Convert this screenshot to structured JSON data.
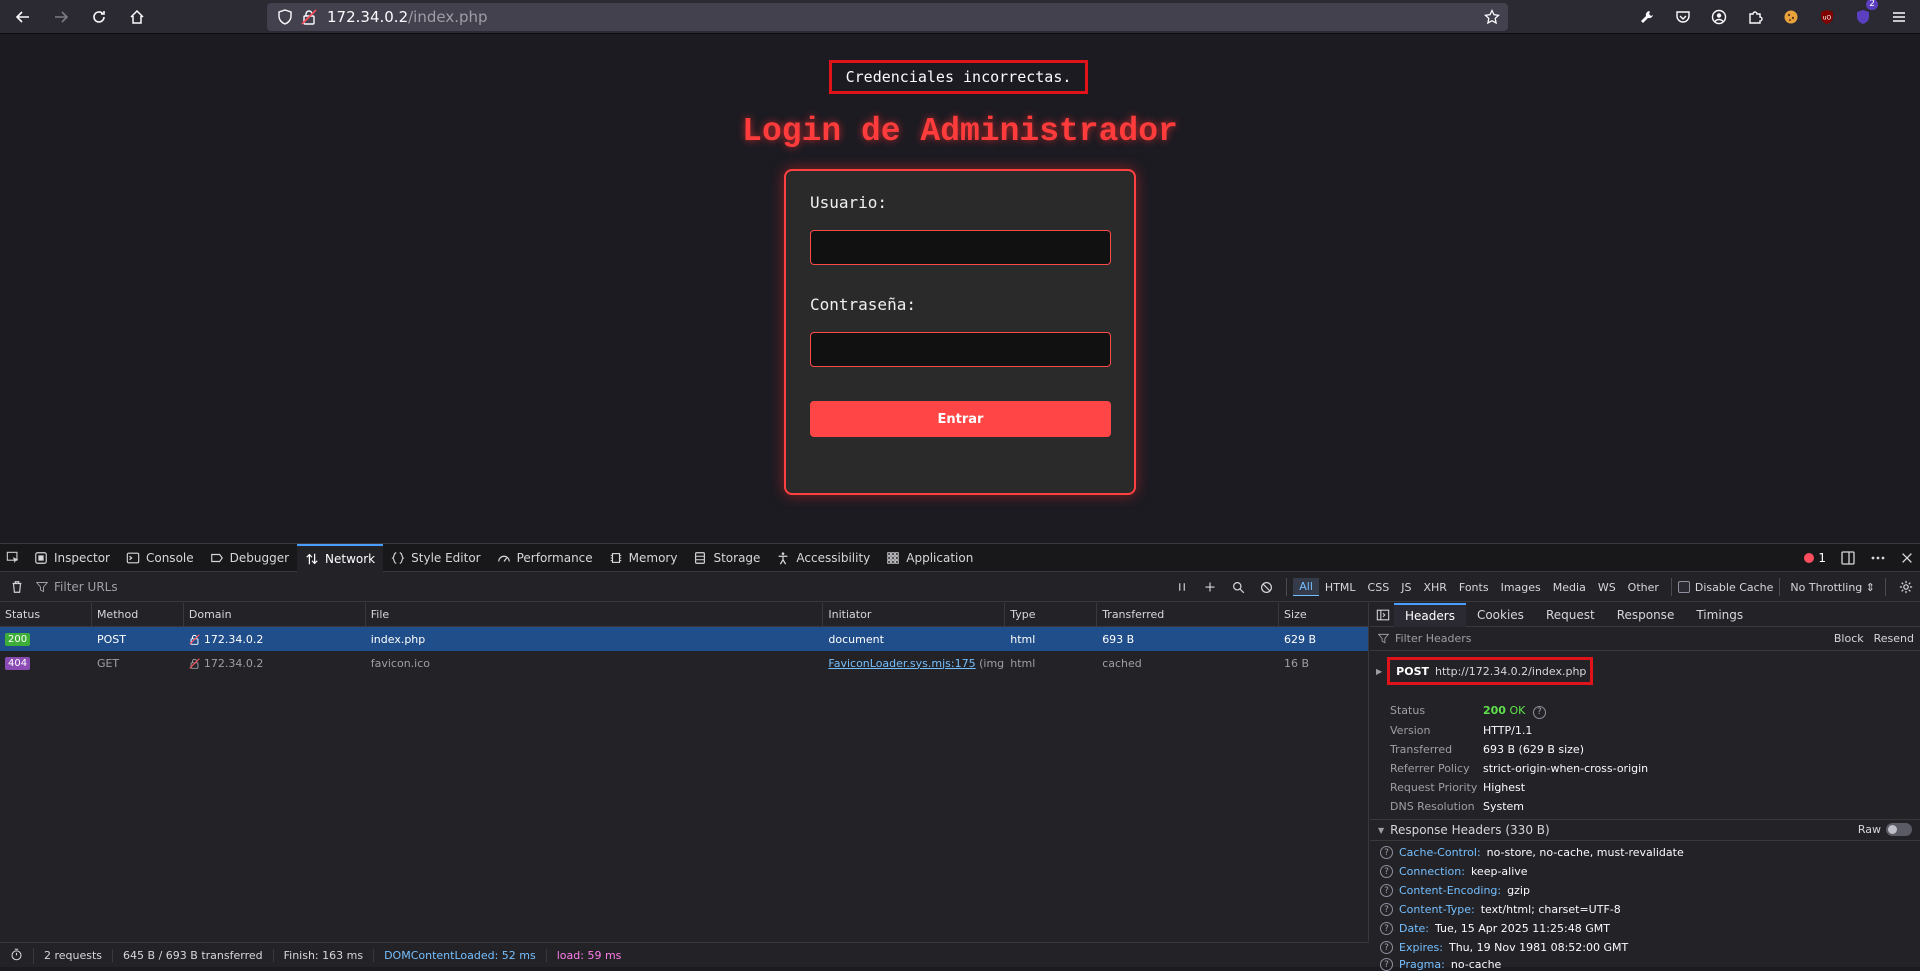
{
  "browser": {
    "url_host": "172.34.0.2",
    "url_path": "/index.php",
    "extension_badge_count": "2"
  },
  "page": {
    "alert_text": "Credenciales incorrectas.",
    "title": "Login de Administrador",
    "username_label": "Usuario:",
    "password_label": "Contraseña:",
    "username_value": "",
    "password_value": "",
    "submit_label": "Entrar"
  },
  "devtools": {
    "tabs": [
      {
        "label": "Inspector",
        "icon": "inspector-icon"
      },
      {
        "label": "Console",
        "icon": "console-icon"
      },
      {
        "label": "Debugger",
        "icon": "debugger-icon"
      },
      {
        "label": "Network",
        "icon": "network-icon"
      },
      {
        "label": "Style Editor",
        "icon": "style-editor-icon"
      },
      {
        "label": "Performance",
        "icon": "performance-icon"
      },
      {
        "label": "Memory",
        "icon": "memory-icon"
      },
      {
        "label": "Storage",
        "icon": "storage-icon"
      },
      {
        "label": "Accessibility",
        "icon": "accessibility-icon"
      },
      {
        "label": "Application",
        "icon": "application-icon"
      }
    ],
    "error_count": "1",
    "filter_placeholder": "Filter URLs",
    "type_filters": [
      "All",
      "HTML",
      "CSS",
      "JS",
      "XHR",
      "Fonts",
      "Images",
      "Media",
      "WS",
      "Other"
    ],
    "disable_cache_label": "Disable Cache",
    "throttling_label": "No Throttling",
    "columns": [
      "Status",
      "Method",
      "Domain",
      "File",
      "Initiator",
      "Type",
      "Transferred",
      "Size"
    ],
    "requests": [
      {
        "status": "200",
        "method": "POST",
        "domain": "172.34.0.2",
        "file": "index.php",
        "initiator": "document",
        "initiator_suffix": "",
        "type": "html",
        "transferred": "693 B",
        "size": "629 B"
      },
      {
        "status": "404",
        "method": "GET",
        "domain": "172.34.0.2",
        "file": "favicon.ico",
        "initiator": "FaviconLoader.sys.mjs:175",
        "initiator_suffix": "(img)",
        "type": "html",
        "transferred": "cached",
        "size": "16 B"
      }
    ],
    "statusbar": {
      "requests": "2 requests",
      "transferred": "645 B / 693 B transferred",
      "finish": "Finish: 163 ms",
      "dcl": "DOMContentLoaded: 52 ms",
      "load": "load: 59 ms"
    },
    "details": {
      "tabs": [
        "Headers",
        "Cookies",
        "Request",
        "Response",
        "Timings"
      ],
      "filter_placeholder": "Filter Headers",
      "block_label": "Block",
      "resend_label": "Resend",
      "method": "POST",
      "url": "http://172.34.0.2/index.php",
      "summary": [
        {
          "k": "Status",
          "v": "OK"
        },
        {
          "k": "Version",
          "v": "HTTP/1.1"
        },
        {
          "k": "Transferred",
          "v": "693 B (629 B size)"
        },
        {
          "k": "Referrer Policy",
          "v": "strict-origin-when-cross-origin"
        },
        {
          "k": "Request Priority",
          "v": "Highest"
        },
        {
          "k": "DNS Resolution",
          "v": "System"
        }
      ],
      "status_code": "200",
      "response_headers_title": "Response Headers (330 B)",
      "raw_label": "Raw",
      "response_headers": [
        {
          "name": "Cache-Control:",
          "value": "no-store, no-cache, must-revalidate"
        },
        {
          "name": "Connection:",
          "value": "keep-alive"
        },
        {
          "name": "Content-Encoding:",
          "value": "gzip"
        },
        {
          "name": "Content-Type:",
          "value": "text/html; charset=UTF-8"
        },
        {
          "name": "Date:",
          "value": "Tue, 15 Apr 2025 11:25:48 GMT"
        },
        {
          "name": "Expires:",
          "value": "Thu, 19 Nov 1981 08:52:00 GMT"
        },
        {
          "name": "Pragma:",
          "value": "no-cache"
        }
      ]
    }
  }
}
